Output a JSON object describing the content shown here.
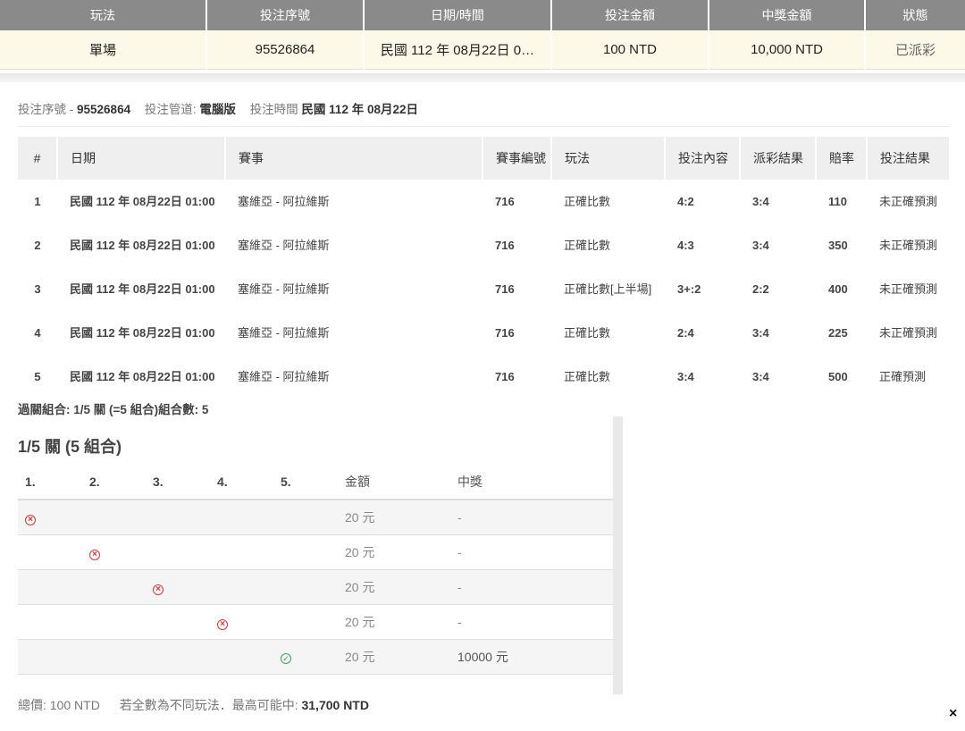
{
  "summary": {
    "headers": [
      "玩法",
      "投注序號",
      "日期/時間",
      "投注金額",
      "中獎金額",
      "狀態"
    ],
    "row": [
      "單場",
      "95526864",
      "民國 112 年 08月22日 0…",
      "100 NTD",
      "10,000 NTD",
      "已派彩"
    ]
  },
  "info": {
    "serial_label": "投注序號 -",
    "serial_value": "95526864",
    "channel_label": "投注管道:",
    "channel_value": "電腦版",
    "time_label": "投注時間",
    "time_value": "民國 112 年 08月22日"
  },
  "detail": {
    "headers": [
      "#",
      "日期",
      "賽事",
      "賽事編號",
      "玩法",
      "投注內容",
      "派彩結果",
      "賠率",
      "投注結果"
    ],
    "rows": [
      {
        "num": "1",
        "date": "民國 112 年 08月22日 01:00",
        "match": "塞維亞 - 阿拉維斯",
        "id": "716",
        "play": "正確比數",
        "bet": "4:2",
        "result": "3:4",
        "odds": "110",
        "outcome": "未正確預測"
      },
      {
        "num": "2",
        "date": "民國 112 年 08月22日 01:00",
        "match": "塞維亞 - 阿拉維斯",
        "id": "716",
        "play": "正確比數",
        "bet": "4:3",
        "result": "3:4",
        "odds": "350",
        "outcome": "未正確預測"
      },
      {
        "num": "3",
        "date": "民國 112 年 08月22日 01:00",
        "match": "塞維亞 - 阿拉維斯",
        "id": "716",
        "play": "正確比數[上半場]",
        "bet": "3+:2",
        "result": "2:2",
        "odds": "400",
        "outcome": "未正確預測"
      },
      {
        "num": "4",
        "date": "民國 112 年 08月22日 01:00",
        "match": "塞維亞 - 阿拉維斯",
        "id": "716",
        "play": "正確比數",
        "bet": "2:4",
        "result": "3:4",
        "odds": "225",
        "outcome": "未正確預測"
      },
      {
        "num": "5",
        "date": "民國 112 年 08月22日 01:00",
        "match": "塞維亞 - 阿拉維斯",
        "id": "716",
        "play": "正確比數",
        "bet": "3:4",
        "result": "3:4",
        "odds": "500",
        "outcome": "正確預測"
      }
    ]
  },
  "combo_summary": "過關組合: 1/5 關 (=5 組合)組合數: 5",
  "combo": {
    "title": "1/5 關 (5 組合)",
    "headers": [
      "1.",
      "2.",
      "3.",
      "4.",
      "5.",
      "金額",
      "中獎"
    ],
    "rows": [
      {
        "pos": 1,
        "icon": "x-circle-icon",
        "amount": "20 元",
        "win": "-"
      },
      {
        "pos": 2,
        "icon": "x-circle-icon",
        "amount": "20 元",
        "win": "-"
      },
      {
        "pos": 3,
        "icon": "x-circle-icon",
        "amount": "20 元",
        "win": "-"
      },
      {
        "pos": 4,
        "icon": "x-circle-icon",
        "amount": "20 元",
        "win": "-"
      },
      {
        "pos": 5,
        "icon": "check-circle-icon",
        "amount": "20 元",
        "win": "10000 元"
      }
    ]
  },
  "footer": {
    "total_label": "總價:",
    "total_value": "100 NTD",
    "note": "若全數為不同玩法．最高可能中:",
    "max_value": "31,700 NTD"
  },
  "close_label": "×",
  "colors": {
    "header_bg": "#8a8a8a",
    "row_bg": "#fcf9e8",
    "lose": "#d9373f",
    "win": "#3aa35a"
  }
}
